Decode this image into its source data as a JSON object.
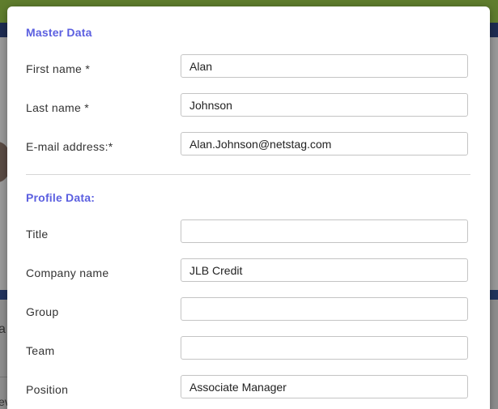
{
  "background": {
    "fragment_a": "a",
    "fragment_b": "ev"
  },
  "master_data": {
    "heading": "Master Data",
    "fields": [
      {
        "label": "First name *",
        "value": "Alan",
        "placeholder": ""
      },
      {
        "label": "Last name *",
        "value": "Johnson",
        "placeholder": ""
      },
      {
        "label": "E-mail address:*",
        "value": "Alan.Johnson@netstag.com",
        "placeholder": ""
      }
    ]
  },
  "profile_data": {
    "heading": "Profile Data:",
    "fields": [
      {
        "label": "Title",
        "value": "",
        "placeholder": ""
      },
      {
        "label": "Company name",
        "value": "JLB Credit",
        "placeholder": ""
      },
      {
        "label": "Group",
        "value": "",
        "placeholder": ""
      },
      {
        "label": "Team",
        "value": "",
        "placeholder": ""
      },
      {
        "label": "Position",
        "value": "Associate Manager",
        "placeholder": ""
      }
    ]
  },
  "colors": {
    "heading": "#5b5fe0",
    "topbar": "#5f7d2d",
    "navbar": "#1d2c52"
  }
}
